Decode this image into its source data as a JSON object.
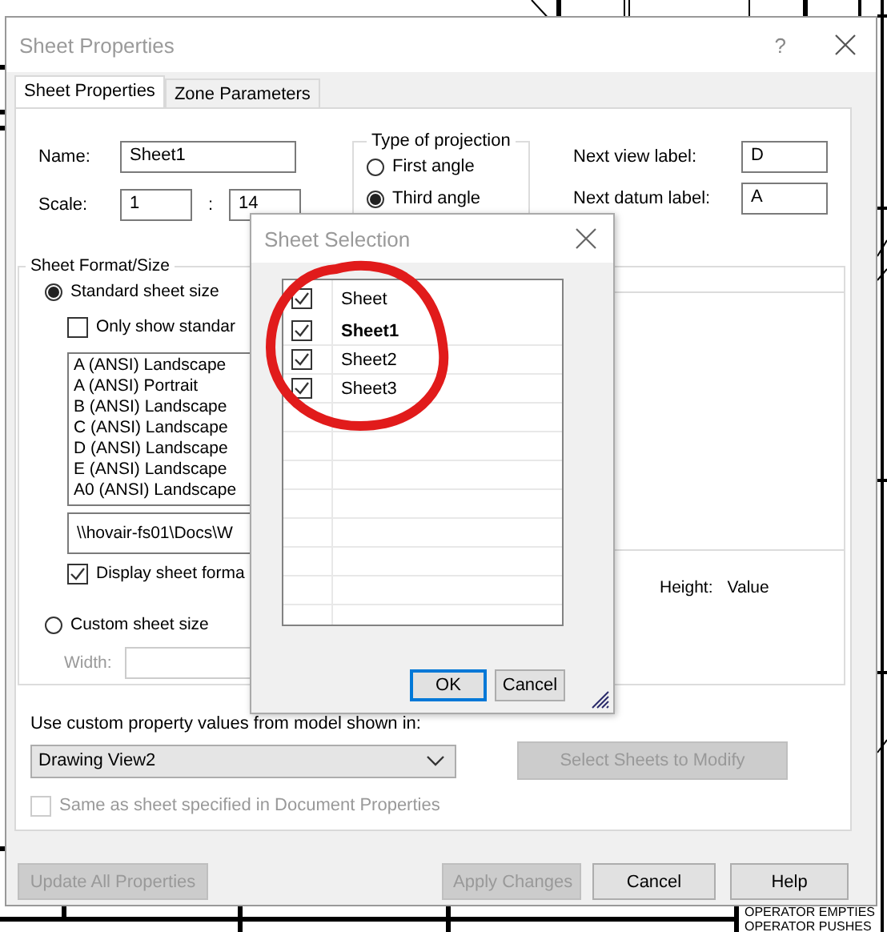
{
  "dialog": {
    "title": "Sheet Properties",
    "help": "?"
  },
  "tabs": [
    {
      "label": "Sheet Properties",
      "selected": true
    },
    {
      "label": "Zone Parameters",
      "selected": false
    }
  ],
  "name": {
    "label": "Name:",
    "value": "Sheet1"
  },
  "scale": {
    "label": "Scale:",
    "numerator": "1",
    "separator": ":",
    "denominator": "14"
  },
  "projection": {
    "title": "Type of projection",
    "options": [
      {
        "label": "First angle",
        "selected": false
      },
      {
        "label": "Third angle",
        "selected": true
      }
    ]
  },
  "next_labels": [
    {
      "label": "Next view label:",
      "value": "D"
    },
    {
      "label": "Next datum label:",
      "value": "A"
    }
  ],
  "sheet_format": {
    "title": "Sheet Format/Size",
    "standard": {
      "label": "Standard sheet size",
      "selected": true
    },
    "only_standard": {
      "label": "Only show standar",
      "checked": false
    },
    "sizes": [
      "A (ANSI) Landscape",
      "A (ANSI) Portrait",
      "B (ANSI) Landscape",
      "C (ANSI) Landscape",
      "D (ANSI) Landscape",
      "E (ANSI) Landscape",
      "A0 (ANSI) Landscape"
    ],
    "path": "\\\\hovair-fs01\\Docs\\W",
    "display_format": {
      "label": "Display sheet forma",
      "checked": true
    },
    "custom": {
      "label": "Custom sheet size",
      "selected": false
    },
    "width_label": "Width:",
    "height_label": "Height:",
    "height_value": "Value"
  },
  "custom_property": {
    "label": "Use custom property values from model shown in:",
    "value": "Drawing View2",
    "select_button": {
      "label": "Select Sheets to Modify",
      "disabled": true
    },
    "same_as": {
      "label": "Same as sheet specified in Document Properties",
      "checked": false,
      "disabled": true
    }
  },
  "buttons": [
    {
      "label": "Update All Properties",
      "disabled": true
    },
    {
      "label": "Apply Changes",
      "disabled": true
    },
    {
      "label": "Cancel",
      "disabled": false
    },
    {
      "label": "Help",
      "disabled": false
    }
  ],
  "sheet_selection": {
    "title": "Sheet Selection",
    "header": {
      "label": "Sheet",
      "checked": true
    },
    "sheets": [
      {
        "label": "Sheet1",
        "checked": true,
        "bold": true
      },
      {
        "label": "Sheet2",
        "checked": true,
        "bold": false
      },
      {
        "label": "Sheet3",
        "checked": true,
        "bold": false
      }
    ],
    "buttons": [
      {
        "label": "OK",
        "focused": true
      },
      {
        "label": "Cancel",
        "focused": false
      }
    ]
  },
  "background": {
    "notes": [
      "OPERATOR EMPTIES",
      "OPERATOR PUSHES"
    ]
  }
}
